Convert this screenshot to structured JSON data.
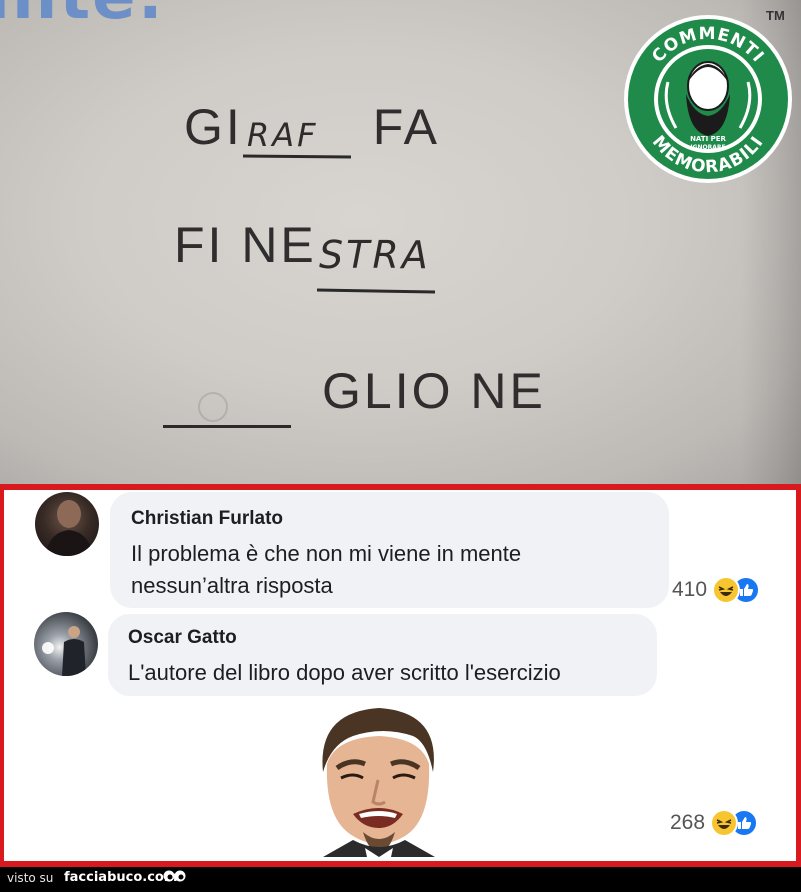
{
  "photo": {
    "cut_text": "nite:",
    "line1": {
      "prefix": "GI",
      "handwritten": "RAF",
      "suffix": "FA"
    },
    "line2": {
      "prefix": "FI NE",
      "handwritten": "STRA"
    },
    "line3": {
      "text": "GLIO NE"
    }
  },
  "badge": {
    "top_text": "COMMENTI",
    "bottom_text": "MEMORABILI",
    "motto_line1": "NATI PER",
    "motto_line2": "IGNORARE",
    "tm": "TM"
  },
  "comments": [
    {
      "author": "Christian Furlato",
      "text_line1": "Il problema è che non mi viene in mente",
      "text_line2": "nessun’altra risposta",
      "reactions": "410",
      "avatar": "avatar-photo"
    },
    {
      "author": "Oscar Gatto",
      "text_line1": "L'autore del libro dopo aver scritto l'esercizio",
      "reactions": "268",
      "avatar": "avatar-photo",
      "attachment": "laughing-meme-sticker"
    }
  ],
  "footer": {
    "prefix": "visto su",
    "site": "facciabuco.com"
  },
  "colors": {
    "frame": "#d8191d",
    "badge_green": "#1f8a4a",
    "haha": "#f7c530",
    "like": "#1877f2"
  }
}
